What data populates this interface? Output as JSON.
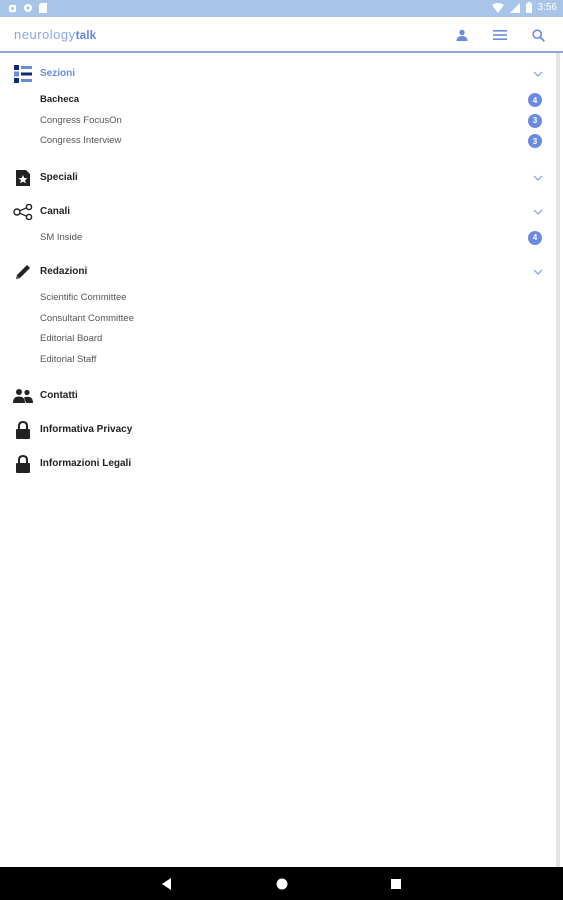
{
  "status_bar": {
    "time": "3:56"
  },
  "app_bar": {
    "logo_main": "neurology",
    "logo_accent": "talk",
    "icons": [
      "user-icon",
      "list-icon",
      "search-icon"
    ]
  },
  "menu": {
    "groups": [
      {
        "title": "Sezioni",
        "icon": "sections-icon",
        "active": true,
        "items": [
          {
            "label": "Bacheca",
            "badge": "4",
            "bold": true
          },
          {
            "label": "Congress FocusOn",
            "badge": "3"
          },
          {
            "label": "Congress Interview",
            "badge": "3"
          }
        ]
      },
      {
        "title": "Speciali",
        "icon": "star-doc-icon"
      },
      {
        "title": "Canali",
        "icon": "share-icon",
        "items": [
          {
            "label": "SM Inside",
            "badge": "4"
          }
        ]
      },
      {
        "title": "Redazioni",
        "icon": "pen-icon",
        "items": [
          {
            "label": "Scientific Committee"
          },
          {
            "label": "Consultant Committee"
          },
          {
            "label": "Editorial Board"
          },
          {
            "label": "Editorial Staff"
          }
        ]
      },
      {
        "title": "Contatti",
        "icon": "people-icon"
      },
      {
        "title": "Informativa Privacy",
        "icon": "lock-icon"
      },
      {
        "title": "Informazioni Legali",
        "icon": "lock-icon"
      }
    ]
  },
  "colors": {
    "accent": "#6a8be0",
    "status_bar": "#a8c4e6",
    "nav_bar": "#000000"
  }
}
